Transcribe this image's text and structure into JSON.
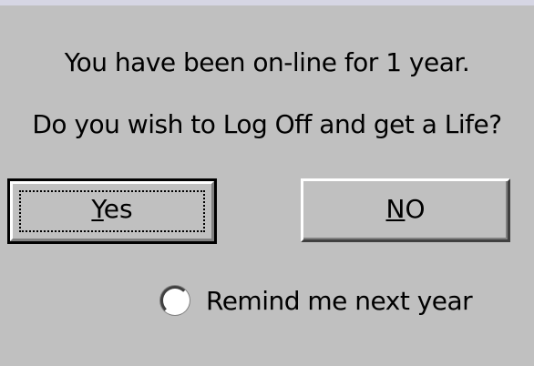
{
  "dialog": {
    "message_line_1": "You have been on-line for 1 year.",
    "message_line_2": "Do you wish to Log Off and get a Life?"
  },
  "buttons": {
    "yes": {
      "accel": "Y",
      "rest": "es"
    },
    "no": {
      "accel": "N",
      "rest": "O"
    }
  },
  "options": {
    "remind_label": "Remind me next year",
    "remind_checked": false
  },
  "colors": {
    "face": "#c0c0c0",
    "highlight": "#ffffff",
    "shadow": "#808080",
    "dark_shadow": "#404040"
  }
}
